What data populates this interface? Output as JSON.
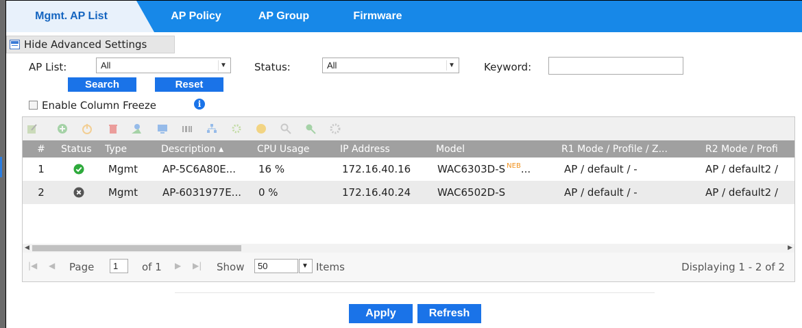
{
  "tabs": [
    {
      "label": "Mgmt. AP List",
      "active": true
    },
    {
      "label": "AP Policy",
      "active": false
    },
    {
      "label": "AP Group",
      "active": false
    },
    {
      "label": "Firmware",
      "active": false
    }
  ],
  "advanced_toggle": "Hide Advanced Settings",
  "filters": {
    "ap_list_label": "AP List:",
    "ap_list_value": "All",
    "status_label": "Status:",
    "status_value": "All",
    "keyword_label": "Keyword:",
    "keyword_value": "",
    "search_label": "Search",
    "reset_label": "Reset"
  },
  "column_freeze_label": "Enable Column Freeze",
  "toolbar_icons": [
    "edit-icon",
    "add-icon",
    "power-icon",
    "delete-icon",
    "user-icon",
    "monitor-icon",
    "barcode-icon",
    "network-icon",
    "gear-icon",
    "circle-icon",
    "search-icon",
    "refresh-icon",
    "settings-icon"
  ],
  "table": {
    "columns": [
      "#",
      "Status",
      "Type",
      "Description ▴",
      "CPU Usage",
      "IP Address",
      "Model",
      "R1 Mode / Profile / Z...",
      "R2 Mode / Profi"
    ],
    "rows": [
      {
        "num": "1",
        "status": "online",
        "type": "Mgmt",
        "description": "AP-5C6A80E...",
        "cpu": "16 %",
        "ip": "172.16.40.16",
        "model": "WAC6303D-S",
        "model_tag": "NEB",
        "model_more": "...",
        "r1": "AP / default / -",
        "r2": "AP / default2 /"
      },
      {
        "num": "2",
        "status": "offline",
        "type": "Mgmt",
        "description": "AP-6031977E...",
        "cpu": "0 %",
        "ip": "172.16.40.24",
        "model": "WAC6502D-S",
        "model_tag": "",
        "model_more": "",
        "r1": "AP / default / -",
        "r2": "AP / default2 /"
      }
    ]
  },
  "pager": {
    "page_label": "Page",
    "page_value": "1",
    "of_label": "of 1",
    "show_label": "Show",
    "show_value": "50",
    "items_label": "Items",
    "displaying": "Displaying 1 - 2 of 2"
  },
  "actions": {
    "apply": "Apply",
    "refresh": "Refresh"
  },
  "colors": {
    "tab_bar": "#1788e8",
    "accent": "#1a73e8",
    "ok": "#2eaa3c",
    "offline": "#555555",
    "neb": "#f0901a"
  }
}
